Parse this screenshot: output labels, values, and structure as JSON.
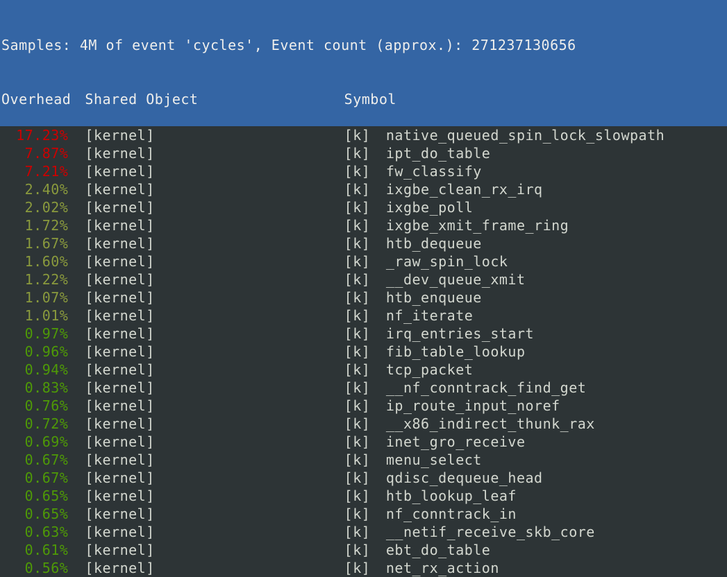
{
  "header": {
    "line1": "Samples: 4M of event 'cycles', Event count (approx.): 271237130656",
    "line2_overhead": "Overhead",
    "line2_shared": "Shared Object",
    "line2_symbol": "Symbol"
  },
  "rows": [
    {
      "overhead": "17.23%",
      "color": "c-red",
      "shared": "[kernel]",
      "tag": "[k]",
      "symbol": "native_queued_spin_lock_slowpath"
    },
    {
      "overhead": "7.87%",
      "color": "c-red",
      "shared": "[kernel]",
      "tag": "[k]",
      "symbol": "ipt_do_table"
    },
    {
      "overhead": "7.21%",
      "color": "c-red",
      "shared": "[kernel]",
      "tag": "[k]",
      "symbol": "fw_classify"
    },
    {
      "overhead": "2.40%",
      "color": "c-olive",
      "shared": "[kernel]",
      "tag": "[k]",
      "symbol": "ixgbe_clean_rx_irq"
    },
    {
      "overhead": "2.02%",
      "color": "c-olive",
      "shared": "[kernel]",
      "tag": "[k]",
      "symbol": "ixgbe_poll"
    },
    {
      "overhead": "1.72%",
      "color": "c-olive",
      "shared": "[kernel]",
      "tag": "[k]",
      "symbol": "ixgbe_xmit_frame_ring"
    },
    {
      "overhead": "1.67%",
      "color": "c-olive",
      "shared": "[kernel]",
      "tag": "[k]",
      "symbol": "htb_dequeue"
    },
    {
      "overhead": "1.60%",
      "color": "c-olive",
      "shared": "[kernel]",
      "tag": "[k]",
      "symbol": "_raw_spin_lock"
    },
    {
      "overhead": "1.22%",
      "color": "c-olive",
      "shared": "[kernel]",
      "tag": "[k]",
      "symbol": "__dev_queue_xmit"
    },
    {
      "overhead": "1.07%",
      "color": "c-olive",
      "shared": "[kernel]",
      "tag": "[k]",
      "symbol": "htb_enqueue"
    },
    {
      "overhead": "1.01%",
      "color": "c-olive",
      "shared": "[kernel]",
      "tag": "[k]",
      "symbol": "nf_iterate"
    },
    {
      "overhead": "0.97%",
      "color": "c-green",
      "shared": "[kernel]",
      "tag": "[k]",
      "symbol": "irq_entries_start"
    },
    {
      "overhead": "0.96%",
      "color": "c-green",
      "shared": "[kernel]",
      "tag": "[k]",
      "symbol": "fib_table_lookup"
    },
    {
      "overhead": "0.94%",
      "color": "c-green",
      "shared": "[kernel]",
      "tag": "[k]",
      "symbol": "tcp_packet"
    },
    {
      "overhead": "0.83%",
      "color": "c-green",
      "shared": "[kernel]",
      "tag": "[k]",
      "symbol": "__nf_conntrack_find_get"
    },
    {
      "overhead": "0.76%",
      "color": "c-green",
      "shared": "[kernel]",
      "tag": "[k]",
      "symbol": "ip_route_input_noref"
    },
    {
      "overhead": "0.72%",
      "color": "c-green",
      "shared": "[kernel]",
      "tag": "[k]",
      "symbol": "__x86_indirect_thunk_rax"
    },
    {
      "overhead": "0.69%",
      "color": "c-green",
      "shared": "[kernel]",
      "tag": "[k]",
      "symbol": "inet_gro_receive"
    },
    {
      "overhead": "0.67%",
      "color": "c-green",
      "shared": "[kernel]",
      "tag": "[k]",
      "symbol": "menu_select"
    },
    {
      "overhead": "0.67%",
      "color": "c-green",
      "shared": "[kernel]",
      "tag": "[k]",
      "symbol": "qdisc_dequeue_head"
    },
    {
      "overhead": "0.65%",
      "color": "c-green",
      "shared": "[kernel]",
      "tag": "[k]",
      "symbol": "htb_lookup_leaf"
    },
    {
      "overhead": "0.65%",
      "color": "c-green",
      "shared": "[kernel]",
      "tag": "[k]",
      "symbol": "nf_conntrack_in"
    },
    {
      "overhead": "0.63%",
      "color": "c-green",
      "shared": "[kernel]",
      "tag": "[k]",
      "symbol": "__netif_receive_skb_core"
    },
    {
      "overhead": "0.61%",
      "color": "c-green",
      "shared": "[kernel]",
      "tag": "[k]",
      "symbol": "ebt_do_table"
    },
    {
      "overhead": "0.56%",
      "color": "c-green",
      "shared": "[kernel]",
      "tag": "[k]",
      "symbol": "net_rx_action"
    }
  ]
}
